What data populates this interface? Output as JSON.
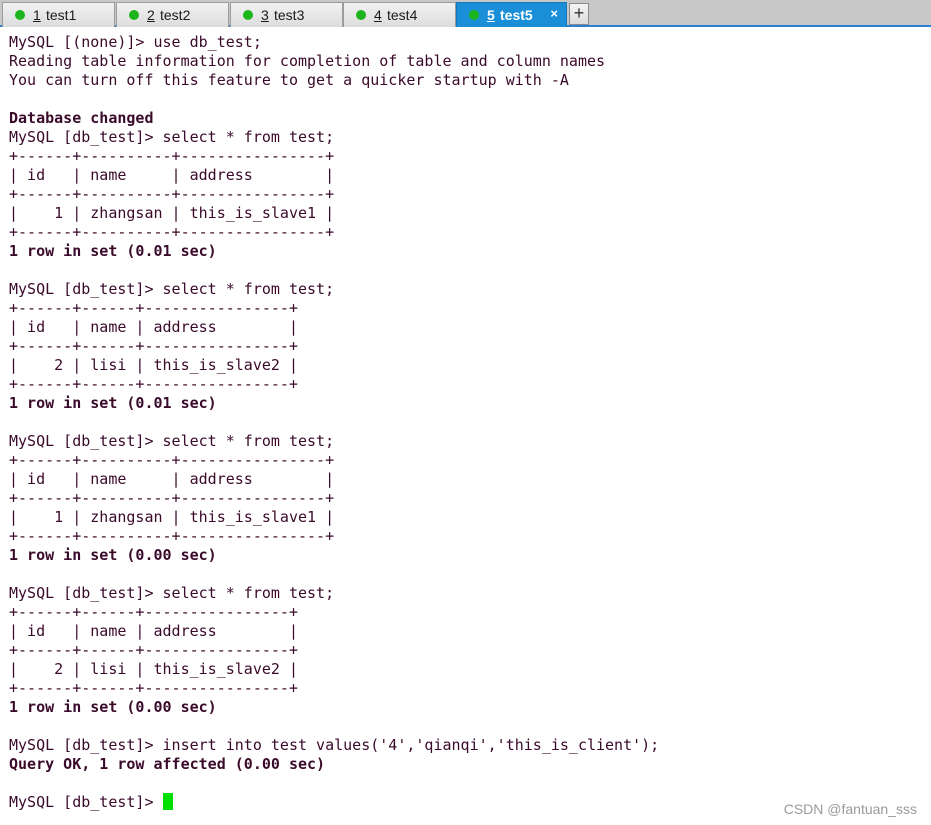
{
  "tabs": [
    {
      "num": "1",
      "name": "test1",
      "active": false
    },
    {
      "num": "2",
      "name": "test2",
      "active": false
    },
    {
      "num": "3",
      "name": "test3",
      "active": false
    },
    {
      "num": "4",
      "name": "test4",
      "active": false
    },
    {
      "num": "5",
      "name": "test5",
      "active": true
    }
  ],
  "tab_close_glyph": "×",
  "add_tab_glyph": "+",
  "terminal": {
    "lines": [
      {
        "text": "MySQL [(none)]> use db_test;"
      },
      {
        "text": "Reading table information for completion of table and column names"
      },
      {
        "text": "You can turn off this feature to get a quicker startup with -A"
      },
      {
        "text": ""
      },
      {
        "text": "Database changed",
        "bold": true
      },
      {
        "text": "MySQL [db_test]> select * from test;"
      },
      {
        "text": "+------+----------+----------------+"
      },
      {
        "text": "| id   | name     | address        |"
      },
      {
        "text": "+------+----------+----------------+"
      },
      {
        "text": "|    1 | zhangsan | this_is_slave1 |"
      },
      {
        "text": "+------+----------+----------------+"
      },
      {
        "text": "1 row in set (0.01 sec)",
        "bold": true
      },
      {
        "text": ""
      },
      {
        "text": "MySQL [db_test]> select * from test;"
      },
      {
        "text": "+------+------+----------------+"
      },
      {
        "text": "| id   | name | address        |"
      },
      {
        "text": "+------+------+----------------+"
      },
      {
        "text": "|    2 | lisi | this_is_slave2 |"
      },
      {
        "text": "+------+------+----------------+"
      },
      {
        "text": "1 row in set (0.01 sec)",
        "bold": true
      },
      {
        "text": ""
      },
      {
        "text": "MySQL [db_test]> select * from test;"
      },
      {
        "text": "+------+----------+----------------+"
      },
      {
        "text": "| id   | name     | address        |"
      },
      {
        "text": "+------+----------+----------------+"
      },
      {
        "text": "|    1 | zhangsan | this_is_slave1 |"
      },
      {
        "text": "+------+----------+----------------+"
      },
      {
        "text": "1 row in set (0.00 sec)",
        "bold": true
      },
      {
        "text": ""
      },
      {
        "text": "MySQL [db_test]> select * from test;"
      },
      {
        "text": "+------+------+----------------+"
      },
      {
        "text": "| id   | name | address        |"
      },
      {
        "text": "+------+------+----------------+"
      },
      {
        "text": "|    2 | lisi | this_is_slave2 |"
      },
      {
        "text": "+------+------+----------------+"
      },
      {
        "text": "1 row in set (0.00 sec)",
        "bold": true
      },
      {
        "text": ""
      },
      {
        "text": "MySQL [db_test]> insert into test values('4','qianqi','this_is_client');"
      },
      {
        "text": "Query OK, 1 row affected (0.00 sec)",
        "bold": true
      },
      {
        "text": ""
      }
    ],
    "prompt": "MySQL [db_test]> "
  },
  "watermark": "CSDN @fantuan_sss",
  "colors": {
    "cursor": "#00e000",
    "active_tab": "#1a8fd8",
    "status_dot": "#1db51d",
    "terminal_text": "#3a0a2a"
  }
}
